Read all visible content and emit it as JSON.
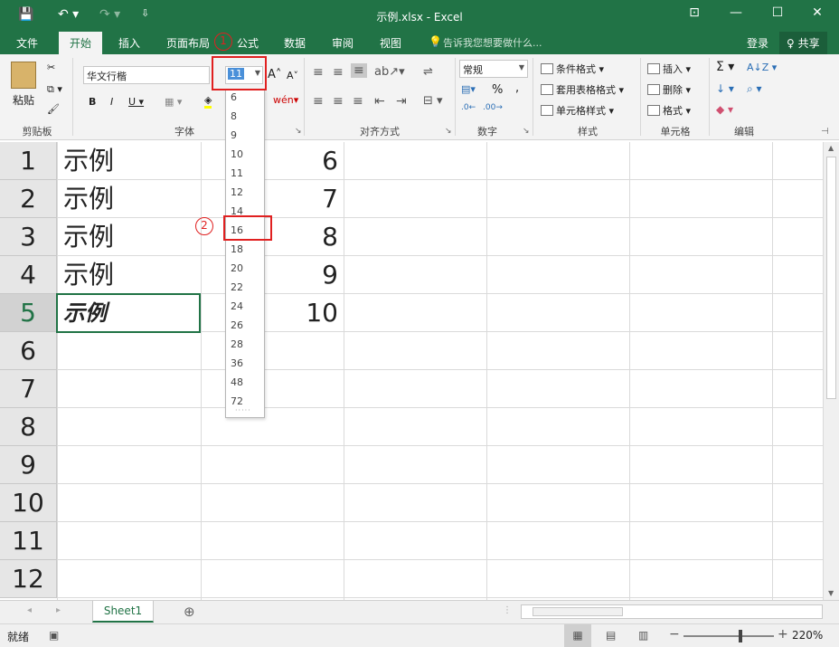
{
  "window": {
    "title": "示例.xlsx - Excel",
    "qat_save": "💾",
    "qat_undo": "↶ ▾",
    "qat_redo": "↷ ▾",
    "qat_more": "⇩",
    "btn_ribbon": "⊡",
    "btn_min": "—",
    "btn_max": "☐",
    "btn_close": "✕"
  },
  "tabs": [
    "文件",
    "开始",
    "插入",
    "页面布局",
    "公式",
    "数据",
    "审阅",
    "视图"
  ],
  "tell_me": "告诉我您想要做什么...",
  "login": "登录",
  "share": "♀ 共享",
  "clipboard": {
    "paste": "粘贴",
    "group": "剪贴板"
  },
  "font": {
    "name": "华文行楷",
    "size": "11",
    "group": "字体",
    "bold": "B",
    "italic": "I",
    "underline": "U ▾",
    "grow": "A˄",
    "shrink": "A˅"
  },
  "alignment": {
    "group": "对齐方式"
  },
  "number": {
    "format": "常规",
    "group": "数字",
    "percent": "%",
    "comma": ","
  },
  "styles": {
    "conditional": "条件格式 ▾",
    "table": "套用表格格式 ▾",
    "cell": "单元格样式 ▾",
    "group": "样式"
  },
  "cells": {
    "insert": "插入 ▾",
    "delete": "删除 ▾",
    "format": "格式 ▾",
    "group": "单元格"
  },
  "editing": {
    "group": "编辑",
    "sum": "Σ ▾",
    "sort": "A↓Z ▾",
    "fill": "↓ ▾",
    "find": "⌕ ▾",
    "clear": "◆ ▾"
  },
  "dropdown": {
    "options": [
      "6",
      "8",
      "9",
      "10",
      "11",
      "12",
      "14",
      "16",
      "18",
      "20",
      "22",
      "24",
      "26",
      "28",
      "36",
      "48",
      "72"
    ],
    "highlighted": "16"
  },
  "annotations": {
    "step1": "1",
    "step2": "2"
  },
  "rows": [
    {
      "num": "1",
      "a": "示例",
      "c": "6"
    },
    {
      "num": "2",
      "a": "示例",
      "c": "7"
    },
    {
      "num": "3",
      "a": "示例",
      "c": "8"
    },
    {
      "num": "4",
      "a": "示例",
      "c": "9"
    },
    {
      "num": "5",
      "a": "示例",
      "c": "10"
    },
    {
      "num": "6",
      "a": "",
      "c": ""
    },
    {
      "num": "7",
      "a": "",
      "c": ""
    },
    {
      "num": "8",
      "a": "",
      "c": ""
    },
    {
      "num": "9",
      "a": "",
      "c": ""
    },
    {
      "num": "10",
      "a": "",
      "c": ""
    },
    {
      "num": "11",
      "a": "",
      "c": ""
    },
    {
      "num": "12",
      "a": "",
      "c": ""
    }
  ],
  "selected_row": "5",
  "sheet": {
    "name": "Sheet1",
    "add": "⊕",
    "nav_prev": "◂",
    "nav_next": "▸"
  },
  "status": {
    "ready": "就绪",
    "zoom": "220%",
    "zoom_minus": "−",
    "zoom_plus": "+"
  },
  "colors": {
    "brand": "#217346",
    "annotation": "#e02020"
  }
}
